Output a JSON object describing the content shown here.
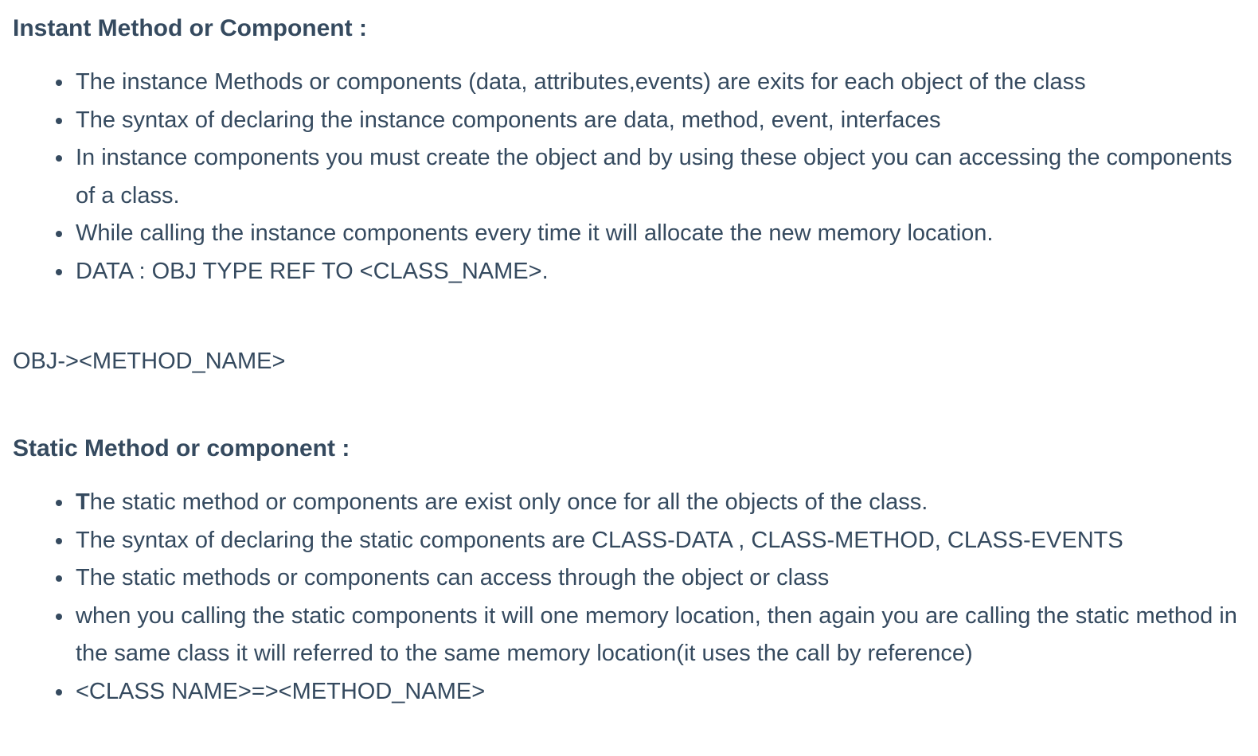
{
  "instant_section": {
    "heading": "Instant Method or Component :",
    "items": [
      "The instance Methods or components (data, attributes,events) are exits for each object of the class",
      "The syntax of declaring the instance components are data, method, event, interfaces",
      "In instance components you must create the object and by using these object you can accessing the components of a class.",
      "While calling the instance components every time it will allocate the new memory location.",
      "DATA : OBJ TYPE REF TO <CLASS_NAME>."
    ]
  },
  "method_call_example": "OBJ-><METHOD_NAME>",
  "static_section": {
    "heading": "Static Method or component :",
    "first_item_initial": "T",
    "first_item_rest": "he static method or components are exist only once for all the objects of the class.",
    "items": [
      "The syntax of declaring the static components are CLASS-DATA , CLASS-METHOD, CLASS-EVENTS",
      "The static methods or components can access through the object or class",
      "when you calling the static components it will one memory location, then again you are calling the static method in the same class it will referred to the same memory location(it uses the call by reference)",
      "<CLASS NAME>=><METHOD_NAME>"
    ]
  }
}
